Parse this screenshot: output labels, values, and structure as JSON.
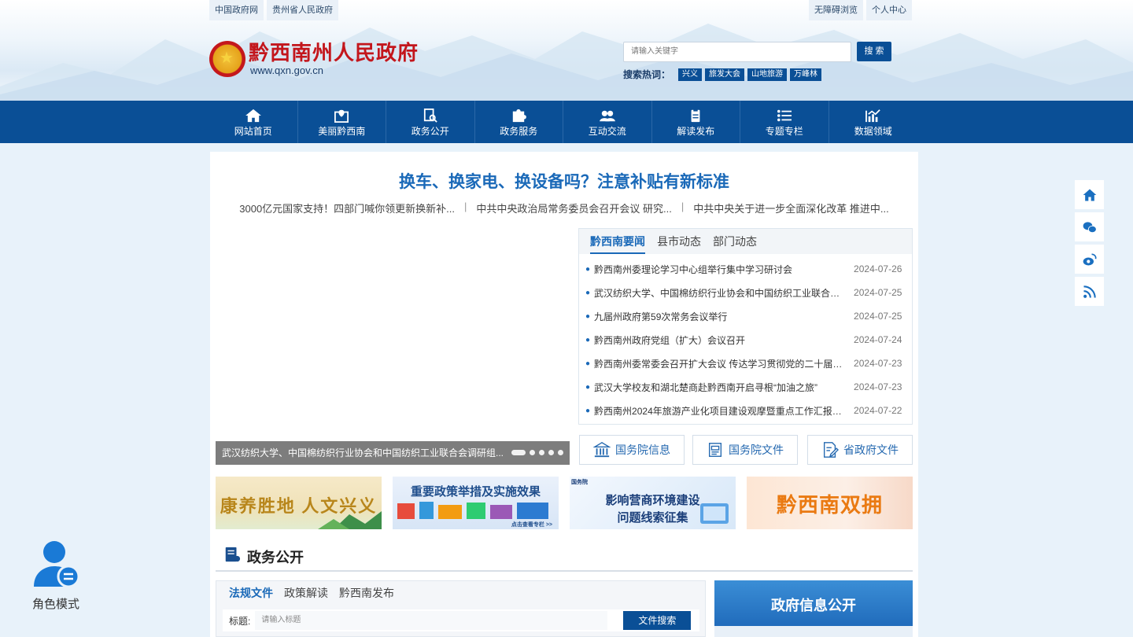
{
  "header": {
    "top_left_links": [
      "中国政府网",
      "贵州省人民政府"
    ],
    "top_right_links": [
      "无障碍浏览",
      "个人中心"
    ],
    "site_title": "黔西南州人民政府",
    "site_url": "www.qxn.gov.cn",
    "search_placeholder": "请输入关键字",
    "search_button": "搜 索",
    "hot_label": "搜索热词：",
    "hot_words": [
      "兴义",
      "旅发大会",
      "山地旅游",
      "万峰林"
    ]
  },
  "nav": {
    "items": [
      {
        "label": "网站首页",
        "icon": "home-icon"
      },
      {
        "label": "美丽黔西南",
        "icon": "map-pin-icon"
      },
      {
        "label": "政务公开",
        "icon": "document-search-icon"
      },
      {
        "label": "政务服务",
        "icon": "puzzle-icon"
      },
      {
        "label": "互动交流",
        "icon": "people-icon"
      },
      {
        "label": "解读发布",
        "icon": "clipboard-icon"
      },
      {
        "label": "专题专栏",
        "icon": "list-icon"
      },
      {
        "label": "数据领域",
        "icon": "chart-icon"
      }
    ]
  },
  "main": {
    "headline": "换车、换家电、换设备吗？注意补贴有新标准",
    "subnews": [
      "3000亿元国家支持！四部门喊你领更新换新补...",
      "中共中央政治局常务委员会召开会议 研究...",
      "中共中央关于进一步全面深化改革 推进中..."
    ],
    "slide_caption": "武汉纺织大学、中国棉纺织行业协会和中国纺织工业联合会调研组...",
    "news_tabs": [
      "黔西南要闻",
      "县市动态",
      "部门动态"
    ],
    "news": [
      {
        "title": "黔西南州委理论学习中心组举行集中学习研讨会",
        "date": "2024-07-26"
      },
      {
        "title": "武汉纺织大学、中国棉纺织行业协会和中国纺织工业联合会调研组...",
        "date": "2024-07-25"
      },
      {
        "title": "九届州政府第59次常务会议举行",
        "date": "2024-07-25"
      },
      {
        "title": "黔西南州政府党组（扩大）会议召开",
        "date": "2024-07-24"
      },
      {
        "title": "黔西南州委常委会召开扩大会议 传达学习贯彻党的二十届三中全会精神",
        "date": "2024-07-23"
      },
      {
        "title": "武汉大学校友和湖北楚商赴黔西南开启寻根“加油之旅”",
        "date": "2024-07-23"
      },
      {
        "title": "黔西南州2024年旅游产业化项目建设观摩暨重点工作汇报会召开",
        "date": "2024-07-22"
      }
    ],
    "quick_links": [
      {
        "label": "国务院信息",
        "icon": "government-building-icon"
      },
      {
        "label": "国务院文件",
        "icon": "file-icon"
      },
      {
        "label": "省政府文件",
        "icon": "edit-document-icon"
      }
    ],
    "banners": [
      {
        "text": "康养胜地 人文兴义",
        "color": "#c69a23"
      },
      {
        "text": "重要政策举措及实施效果",
        "sub": "点击查看专栏 >>",
        "color": "#1f4e8c"
      },
      {
        "text": "影响营商环境建设",
        "text2": "问题线索征集",
        "tag": "国务院",
        "color": "#1b3f7a"
      },
      {
        "text": "黔西南双拥",
        "color": "#e8761c"
      }
    ],
    "section_title": "政务公开",
    "law_tabs": [
      "法规文件",
      "政策解读",
      "黔西南发布"
    ],
    "law_form_label": "标题:",
    "law_form_placeholder": "请输入标题",
    "law_form_button": "文件搜索",
    "gov_info_title": "政府信息公开"
  },
  "role_mode": "角色模式"
}
